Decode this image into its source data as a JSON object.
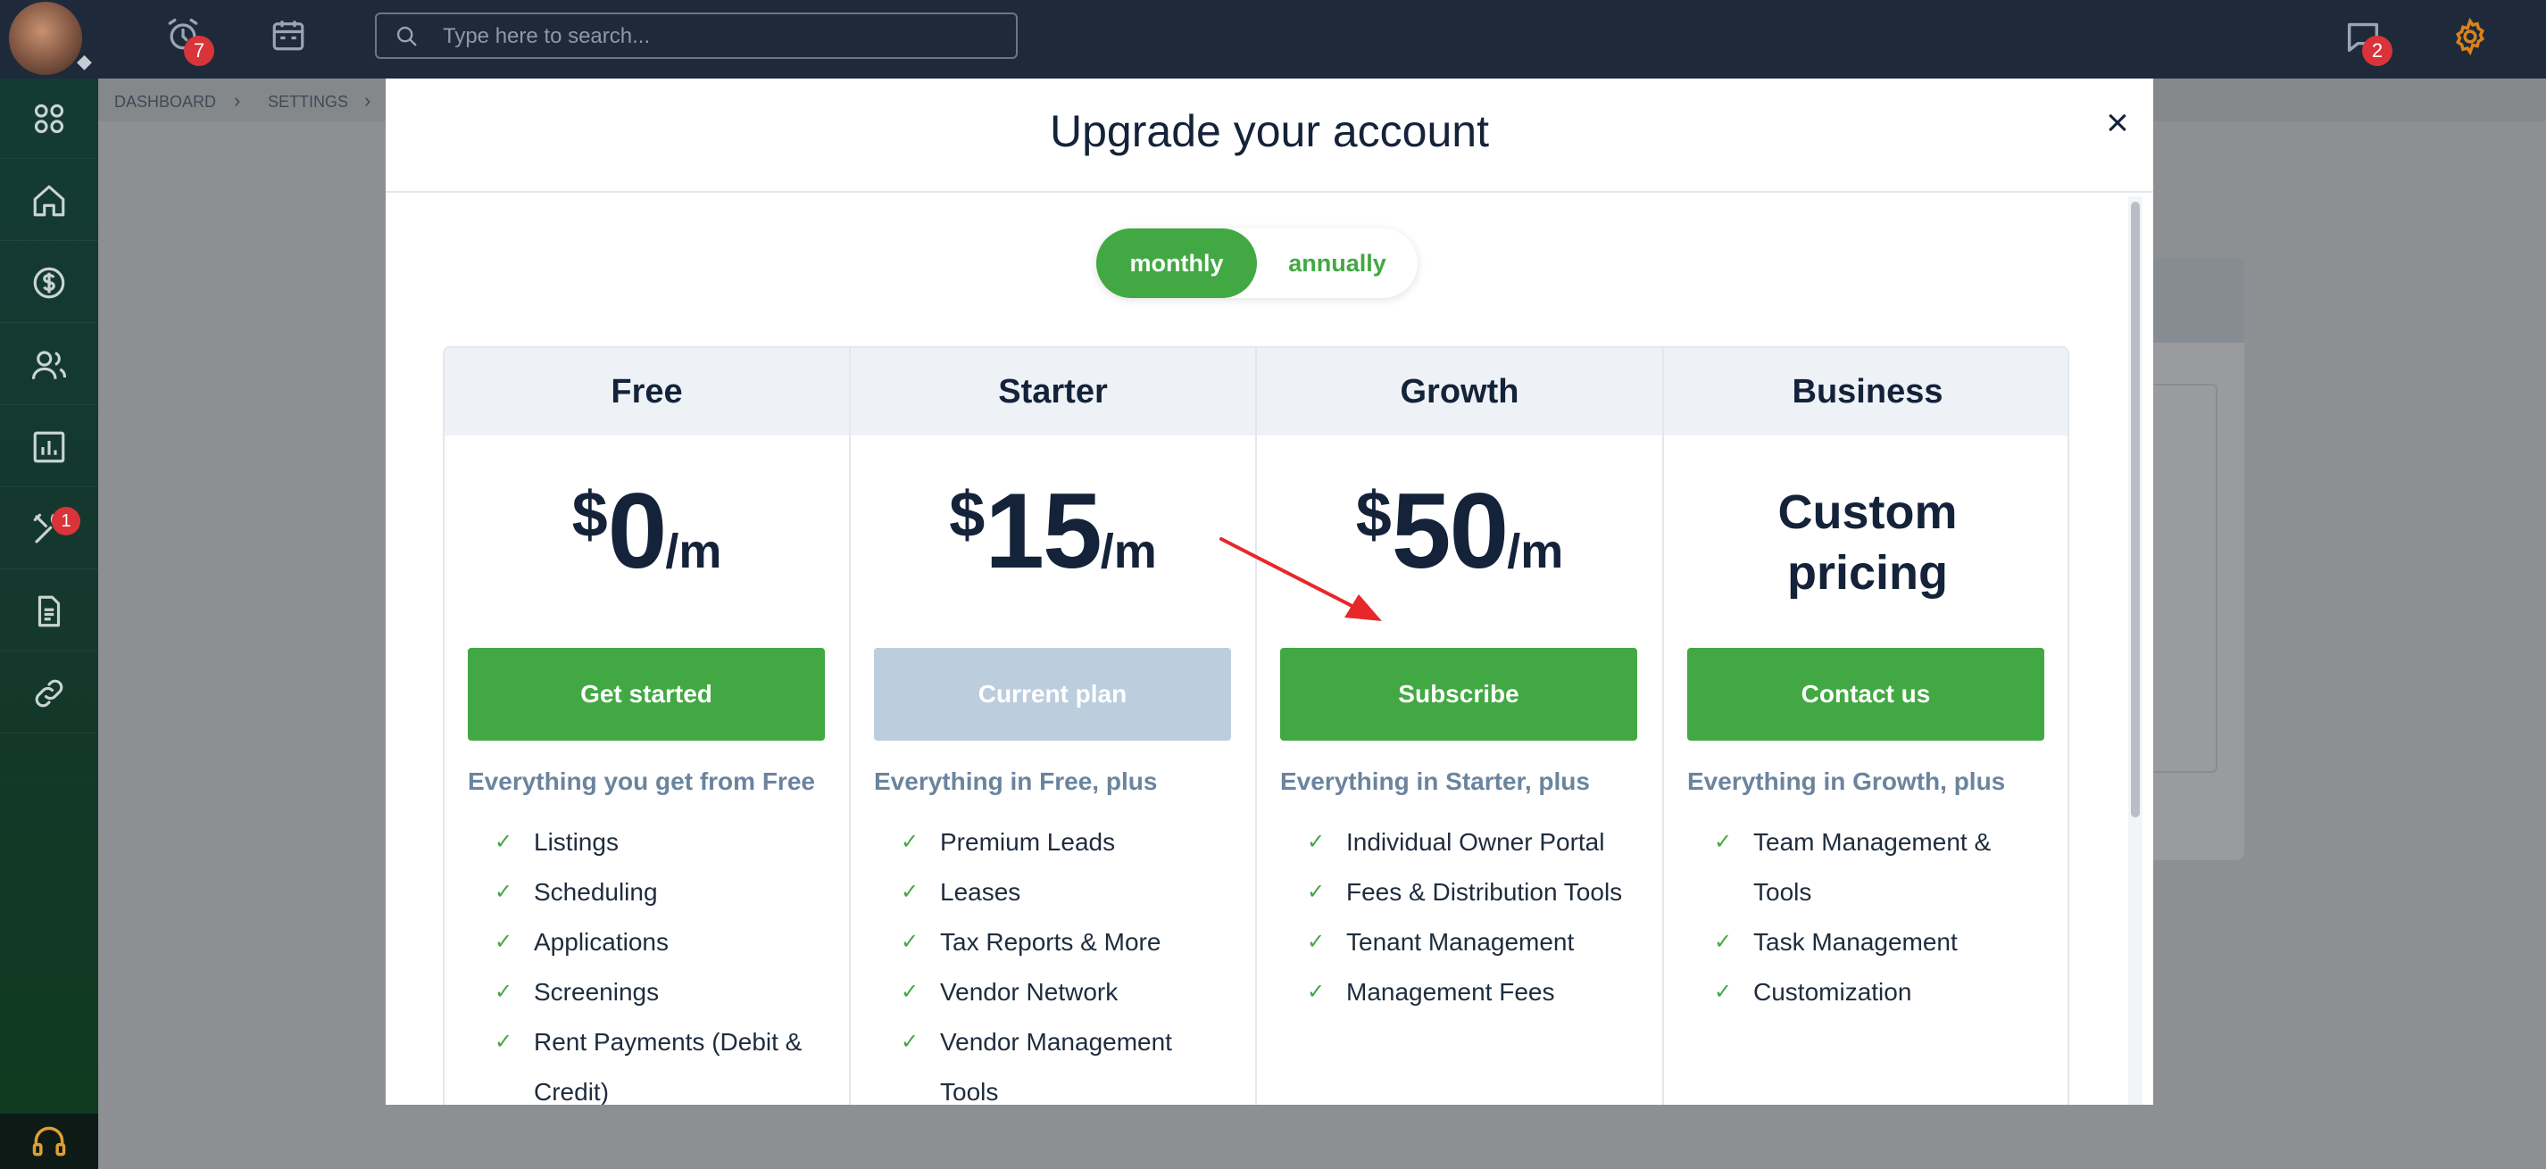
{
  "header": {
    "search_placeholder": "Type here to search...",
    "alerts_count": "7",
    "messages_count": "2",
    "icons": [
      "avatar",
      "alarm-icon",
      "calendar-icon",
      "search-icon",
      "chat-icon",
      "gear-icon"
    ]
  },
  "breadcrumb": {
    "items": [
      "DASHBOARD",
      "SETTINGS"
    ]
  },
  "sidebar": {
    "items": [
      {
        "name": "apps",
        "icon": "grid-icon"
      },
      {
        "name": "home",
        "icon": "home-icon"
      },
      {
        "name": "payments",
        "icon": "dollar-icon"
      },
      {
        "name": "people",
        "icon": "people-icon"
      },
      {
        "name": "reports",
        "icon": "chart-icon"
      },
      {
        "name": "maintenance",
        "icon": "tools-icon",
        "badge": "1"
      },
      {
        "name": "documents",
        "icon": "document-icon"
      },
      {
        "name": "links",
        "icon": "link-icon"
      },
      {
        "name": "support",
        "icon": "headset-icon"
      }
    ]
  },
  "modal": {
    "title": "Upgrade your account",
    "close": "×",
    "toggle": {
      "active": "monthly",
      "inactive": "annually"
    },
    "plans": [
      {
        "name": "Free",
        "currency": "$",
        "amount": "0",
        "period": "/m",
        "cta": "Get started",
        "intro": "Everything you get from Free",
        "features": [
          "Listings",
          "Scheduling",
          "Applications",
          "Screenings",
          "Rent Payments (Debit & Credit)"
        ]
      },
      {
        "name": "Starter",
        "currency": "$",
        "amount": "15",
        "period": "/m",
        "cta": "Current plan",
        "intro": "Everything in Free, plus",
        "features": [
          "Premium Leads",
          "Leases",
          "Tax Reports & More",
          "Vendor Network",
          "Vendor Management Tools"
        ]
      },
      {
        "name": "Growth",
        "currency": "$",
        "amount": "50",
        "period": "/m",
        "cta": "Subscribe",
        "intro": "Everything in Starter, plus",
        "features": [
          "Individual Owner Portal",
          "Fees & Distribution Tools",
          "Tenant Management",
          "Management Fees"
        ]
      },
      {
        "name": "Business",
        "custom_line1": "Custom",
        "custom_line2": "pricing",
        "cta": "Contact us",
        "intro": "Everything in Growth, plus",
        "features": [
          "Team Management & Tools",
          "Task Management",
          "Customization"
        ]
      }
    ]
  },
  "colors": {
    "accent_green": "#42a843",
    "navy": "#1e2a3a",
    "disabled_button": "#bccdde",
    "annotation_arrow": "#e8272b"
  }
}
